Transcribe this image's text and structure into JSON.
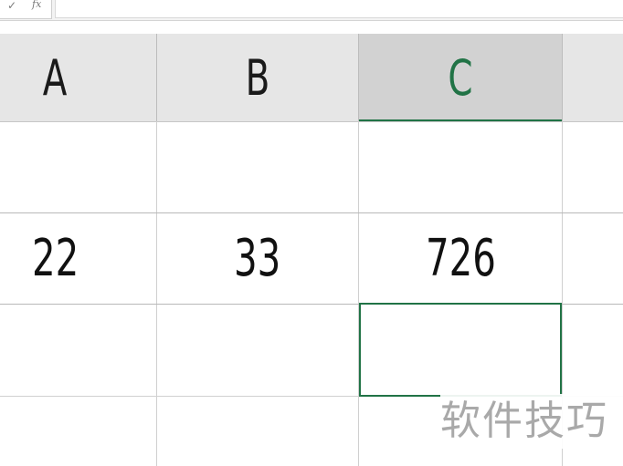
{
  "formula_bar": {
    "check_symbol": "✓",
    "fx_symbol": "fx",
    "value": ""
  },
  "columns": [
    {
      "label": "A",
      "selected": false
    },
    {
      "label": "B",
      "selected": false
    },
    {
      "label": "C",
      "selected": true
    }
  ],
  "rows": [
    {
      "A": "",
      "B": "",
      "C": ""
    },
    {
      "A": "22",
      "B": "33",
      "C": "726"
    },
    {
      "A": "",
      "B": "",
      "C": ""
    },
    {
      "A": "",
      "B": "",
      "C": ""
    }
  ],
  "active_cell": {
    "column": "C",
    "row_index": 2
  },
  "watermark": "软件技巧",
  "colors": {
    "selection_accent": "#217346",
    "header_bg": "#e6e6e6",
    "header_selected_bg": "#d2d2d2",
    "grid_line": "#d0d0d0"
  }
}
